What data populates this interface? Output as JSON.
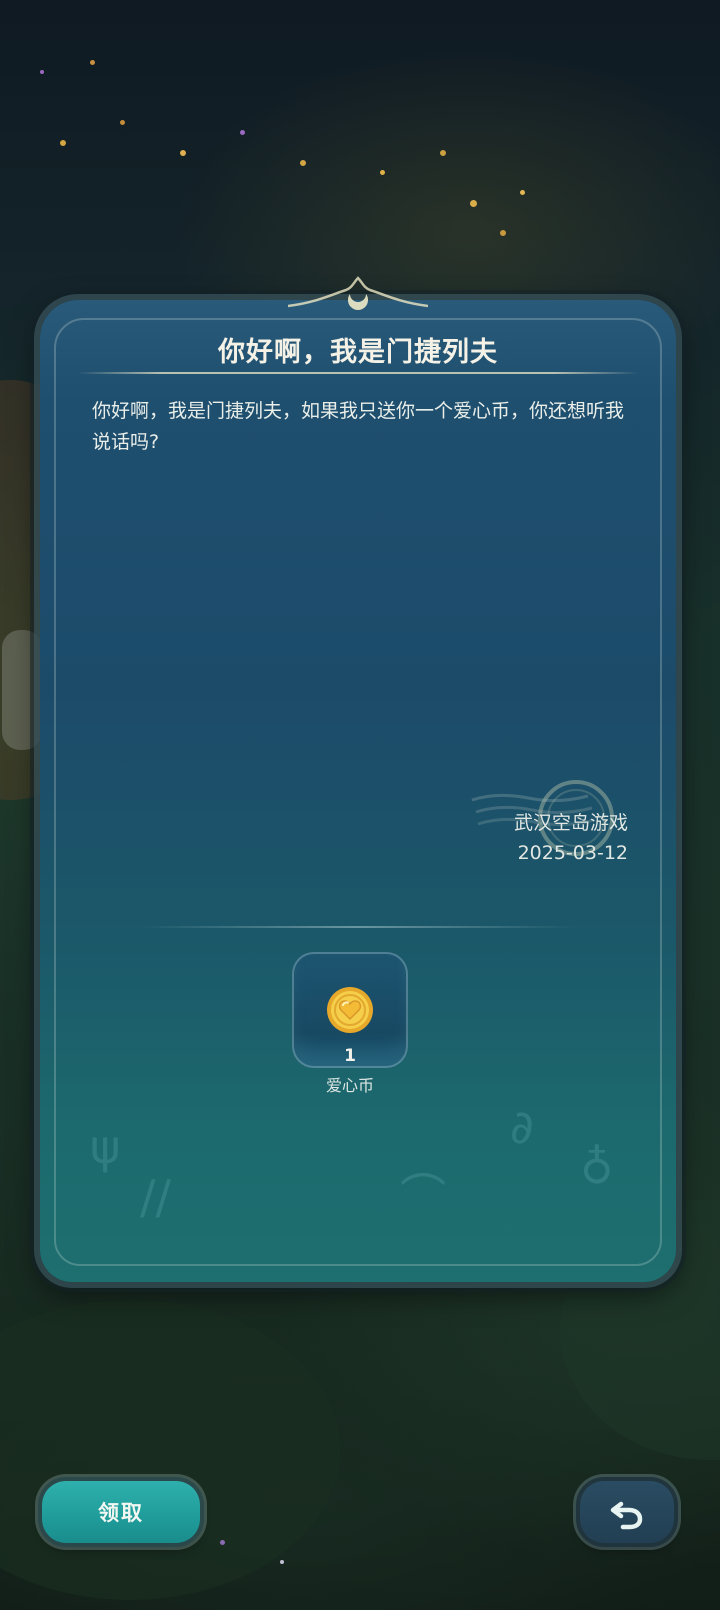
{
  "letter": {
    "title": "你好啊，我是门捷列夫",
    "body": "你好啊，我是门捷列夫，如果我只送你一个爱心币，你还想听我说话吗?",
    "signature_sender": "武汉空岛游戏",
    "signature_date": "2025-03-12"
  },
  "reward": {
    "icon": "heart-coin-icon",
    "count": "1",
    "name": "爱心币"
  },
  "buttons": {
    "claim_label": "领取",
    "back_icon": "return-arrow-icon"
  },
  "colors": {
    "panel": "#1f4f6f",
    "claim_button": "#2fb0ad",
    "back_button": "#2a4c62",
    "coin": "#f2c23a"
  }
}
